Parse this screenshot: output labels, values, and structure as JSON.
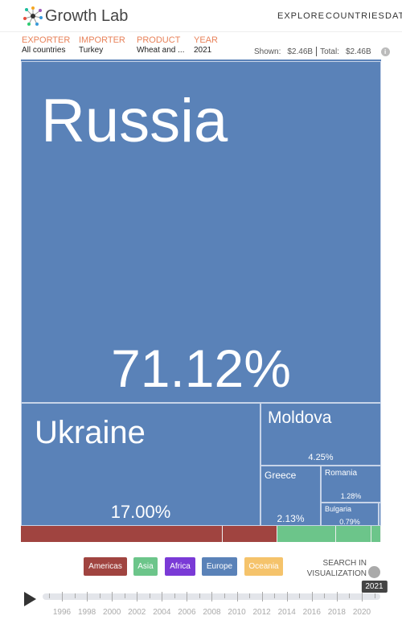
{
  "header": {
    "logo": "Growth Lab",
    "nav": [
      "EXPLORE",
      "COUNTRIES",
      "DATA"
    ]
  },
  "filters": [
    {
      "label": "EXPORTER",
      "value": "All countries"
    },
    {
      "label": "IMPORTER",
      "value": "Turkey"
    },
    {
      "label": "PRODUCT",
      "value": "Wheat and ..."
    },
    {
      "label": "YEAR",
      "value": "2021"
    }
  ],
  "totals": {
    "shown_label": "Shown:",
    "shown": "$2.46B",
    "total_label": "Total:",
    "total": "$2.46B"
  },
  "treemap": [
    {
      "name": "Russia",
      "share": "71.12%"
    },
    {
      "name": "Ukraine",
      "share": "17.00%"
    },
    {
      "name": "Moldova",
      "share": "4.25%"
    },
    {
      "name": "Greece",
      "share": "2.13%"
    },
    {
      "name": "Romania",
      "share": "1.28%"
    },
    {
      "name": "Bulgaria",
      "share": "0.79%"
    }
  ],
  "legend": [
    {
      "label": "Americas",
      "color": "#a04440"
    },
    {
      "label": "Asia",
      "color": "#6cc58a"
    },
    {
      "label": "Africa",
      "color": "#7a3ad6"
    },
    {
      "label": "Europe",
      "color": "#5a82b8"
    },
    {
      "label": "Oceania",
      "color": "#f5c36b"
    }
  ],
  "search": {
    "line1": "SEARCH IN",
    "line2": "VISUALIZATION"
  },
  "timeline": {
    "selected": "2021",
    "labels": [
      "1996",
      "1998",
      "2000",
      "2002",
      "2004",
      "2006",
      "2008",
      "2010",
      "2012",
      "2014",
      "2016",
      "2018",
      "2020"
    ],
    "start": 1995,
    "end": 2021
  }
}
